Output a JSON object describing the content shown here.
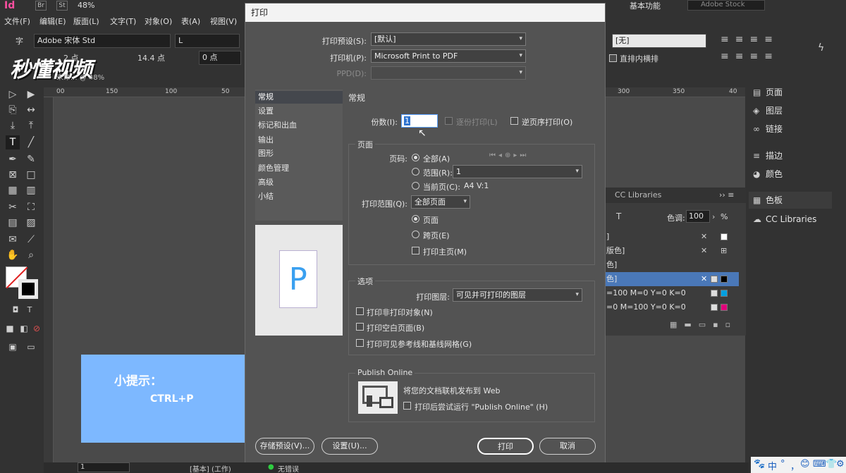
{
  "app": {
    "logo": "Id",
    "apps": [
      "Br",
      "St"
    ],
    "zoom": "48%",
    "workspace": "基本功能",
    "search_placeholder": "Adobe Stock",
    "menu": [
      "文件(F)",
      "编辑(E)",
      "版面(L)",
      "文字(T)",
      "对象(O)",
      "表(A)",
      "视图(V)"
    ]
  },
  "controlbar": {
    "char_label": "字",
    "font_family": "Adobe 宋体 Std",
    "font_style": "L",
    "size_label": "2 点",
    "leading_label": "14.4 点",
    "tracking": "0 点",
    "style_none": "[无]",
    "vertical_option": "直排内横排"
  },
  "doc": {
    "tab": "未命... @ 48%",
    "ruler": [
      "00",
      "150",
      "100",
      "50",
      "300",
      "350",
      "40"
    ]
  },
  "watermark": "秒懂视频",
  "tip": {
    "title": "小提示：",
    "key": "CTRL+P"
  },
  "right_dock": {
    "items": [
      "页面",
      "图层",
      "链接",
      "描边",
      "颜色",
      "色板",
      "CC Libraries"
    ]
  },
  "swatches": {
    "tab": "CC Libraries",
    "tint_label": "色调:",
    "tint_value": "100",
    "tint_unit": "%",
    "rows": [
      "]",
      "版色]",
      "色]",
      "色]",
      "=100 M=0 Y=0 K=0",
      "=0 M=100 Y=0 K=0"
    ]
  },
  "dialog": {
    "title": "打印",
    "preset_label": "打印预设(S):",
    "preset_value": "[默认]",
    "printer_label": "打印机(P):",
    "printer_value": "Microsoft Print to PDF",
    "ppd_label": "PPD(D):",
    "ppd_value": "",
    "nav": [
      "常规",
      "设置",
      "标记和出血",
      "输出",
      "图形",
      "颜色管理",
      "高级",
      "小结"
    ],
    "preview_letter": "P",
    "section_title": "常规",
    "copies_label": "份数(I):",
    "copies_value": "1",
    "collate_label": "逐份打印(L)",
    "reverse_label": "逆页序打印(O)",
    "pages_group": "页面",
    "pages_label": "页码:",
    "all_label": "全部(A)",
    "range_label": "范围(R):",
    "range_value": "1",
    "current_label": "当前页(C):",
    "current_value": "A4 V:1",
    "print_range_label": "打印范围(Q):",
    "print_range_value": "全部页面",
    "pages_opt": "页面",
    "spreads_opt": "跨页(E)",
    "master_opt": "打印主页(M)",
    "options_group": "选项",
    "layers_label": "打印图层:",
    "layers_value": "可见并可打印的图层",
    "nonprint_opt": "打印非打印对象(N)",
    "blank_opt": "打印空白页面(B)",
    "guides_opt": "打印可见参考线和基线网格(G)",
    "publish_group": "Publish Online",
    "publish_text": "将您的文档联机发布到 Web",
    "publish_check": "打印后尝试运行 \"Publish Online\" (H)",
    "btn_save_preset": "存储预设(V)...",
    "btn_setup": "设置(U)...",
    "btn_print": "打印",
    "btn_cancel": "取消"
  },
  "status": {
    "page": "1",
    "master": "[基本] (工作)",
    "errors": "无错误"
  },
  "taskbar": [
    "中",
    "°",
    "，",
    "😊",
    "⌨",
    "👕",
    "⚙"
  ]
}
